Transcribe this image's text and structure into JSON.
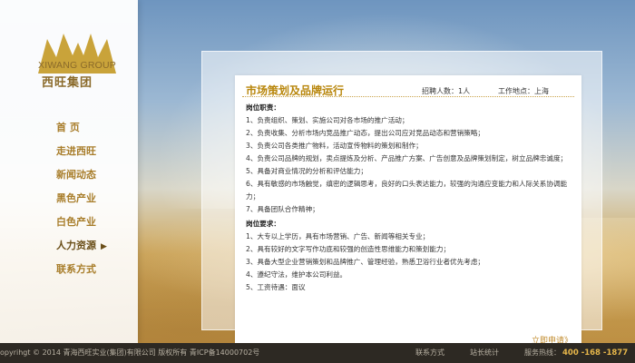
{
  "brand": {
    "name_en": "XIWANG GROUP",
    "name_cn": "西旺集团",
    "logo_color": "#c9a33a"
  },
  "nav": {
    "items": [
      {
        "label": "首    页",
        "active": false
      },
      {
        "label": "走进西旺",
        "active": false
      },
      {
        "label": "新闻动态",
        "active": false
      },
      {
        "label": "黑色产业",
        "active": false
      },
      {
        "label": "白色产业",
        "active": false
      },
      {
        "label": "人力资源",
        "active": true
      },
      {
        "label": "联系方式",
        "active": false
      }
    ]
  },
  "job": {
    "title": "市场策划及品牌运行",
    "count": "招聘人数：1人",
    "location": "工作地点：上海",
    "duties_heading": "岗位职责：",
    "duties": [
      "1、负责组织、策划、实施公司对各市场的推广活动；",
      "2、负责收集、分析市场内竞品推广动态，提出公司应对竞品动态和营销策略；",
      "3、负责公司各类推广物料，活动宣传物料的策划和制作；",
      "4、负责公司品牌的规划，卖点提炼及分析、产品推广方案、广告创意及品牌策划制定，树立品牌忠诚度；",
      "5、具备对商业情况的分析和评估能力；",
      "6、具有敏感的市场触觉，缜密的逻辑思考，良好的口头表达能力，较强的沟通应变能力和人际关系协调能力；",
      "7、具备团队合作精神；"
    ],
    "reqs_heading": "岗位要求：",
    "reqs": [
      "1、大专以上学历，具有市场营销、广告、新闻等相关专业；",
      "2、具有较好的文字写作功底和较强的创造性思维能力和策划能力；",
      "3、具备大型企业营销策划和品牌推广、管理经验，熟悉卫浴行业者优先考虑；",
      "4、遵纪守法，维护本公司利益。",
      "5、工资待遇：面议"
    ],
    "apply_label": "立即申请》"
  },
  "footer": {
    "copyright": "opyrihgt © 2014 青海西旺实业(集团)有限公司 版权所有 青ICP备14000702号",
    "contact": "联系方式",
    "stats": "站长统计",
    "hotline_label": "服务热线：",
    "hotline": "400 -168 -1877"
  }
}
